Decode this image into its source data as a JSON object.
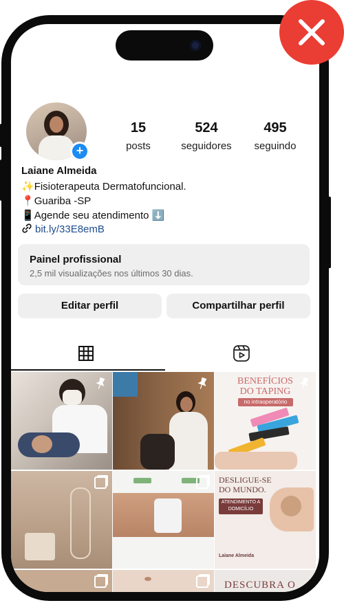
{
  "profile": {
    "name": "Laiane Almeida",
    "stats": [
      {
        "value": "15",
        "label": "posts"
      },
      {
        "value": "524",
        "label": "seguidores"
      },
      {
        "value": "495",
        "label": "seguindo"
      }
    ],
    "bio": [
      {
        "emoji": "✨",
        "text": "Fisioterapeuta Dermatofuncional."
      },
      {
        "emoji": "📍",
        "text": "Guariba -SP"
      },
      {
        "emoji": "📱",
        "text": "Agende seu atendimento ⬇️"
      }
    ],
    "link": "bit.ly/33E8emB"
  },
  "panel": {
    "title": "Painel profissional",
    "subtitle": "2,5 mil visualizações nos últimos 30 dias."
  },
  "actions": {
    "edit": "Editar perfil",
    "share": "Compartilhar perfil"
  },
  "tabs": [
    {
      "icon": "grid-icon",
      "active": true
    },
    {
      "icon": "reels-icon",
      "active": false
    }
  ],
  "posts": {
    "taping_title_1": "BENEFÍCIOS",
    "taping_title_2": "DO TAPING",
    "taping_sub": "no intraoperatório",
    "home_title_1": "DESLIGUE-SE",
    "home_title_2": "DO MUNDO.",
    "home_badge": "ATENDIMENTO A DOMICÍLIO",
    "home_sig": "Laiane Almeida",
    "discover": "DESCUBRA O"
  },
  "colors": {
    "close_badge": "#ea3d34",
    "link": "#1f4d8f",
    "badge_blue": "#1d8bf2",
    "button_bg": "#efefef"
  }
}
